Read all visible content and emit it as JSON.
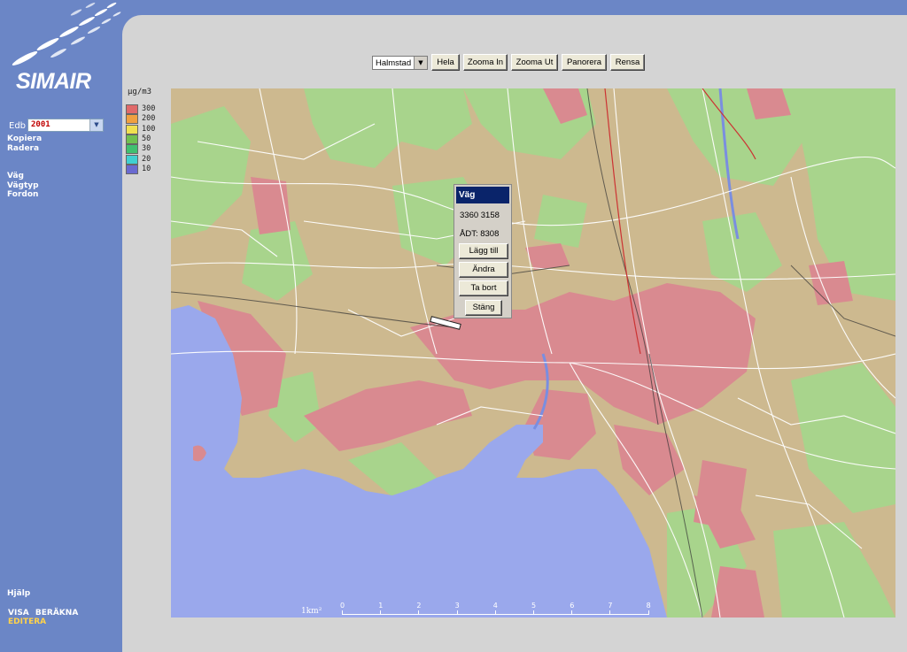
{
  "app": {
    "brand": "SIMAIR"
  },
  "sidebar": {
    "edb_label": "Edb",
    "edb_value": "2001",
    "links_top": [
      "Kopiera",
      "Radera"
    ],
    "links_edit": [
      "Väg",
      "Vägtyp",
      "Fordon"
    ],
    "help": "Hjälp",
    "nav": [
      {
        "label": "VISA",
        "color": "#ffffff"
      },
      {
        "label": "BERÄKNA",
        "color": "#ffffff"
      },
      {
        "label": "EDITERA",
        "color": "#ffd24a"
      }
    ]
  },
  "legend": {
    "unit": "µg/m3",
    "items": [
      {
        "label": "300",
        "color": "#e06a6a"
      },
      {
        "label": "200",
        "color": "#f0a040"
      },
      {
        "label": "100",
        "color": "#f0e050"
      },
      {
        "label": "50",
        "color": "#70c050"
      },
      {
        "label": "30",
        "color": "#40c070"
      },
      {
        "label": "20",
        "color": "#40d0d0"
      },
      {
        "label": "10",
        "color": "#6a6ad0"
      }
    ]
  },
  "toolbar": {
    "city_select": "Halmstad",
    "buttons": [
      "Hela",
      "Zooma In",
      "Zooma Ut",
      "Panorera",
      "Rensa"
    ]
  },
  "popup": {
    "title": "Väg",
    "coords": "3360 3158",
    "adt": "ÅDT: 8308",
    "buttons": [
      "Lägg till",
      "Ändra",
      "Ta bort",
      "Stäng"
    ]
  },
  "scale": {
    "label": "1km²",
    "ticks": [
      "0",
      "1",
      "2",
      "3",
      "4",
      "5",
      "6",
      "7",
      "8"
    ]
  },
  "colors": {
    "sidebar": "#6b86c6",
    "content_bg": "#d4d4d4",
    "map_land": "#cdb98f",
    "map_urban": "#d98a90",
    "map_forest": "#a8d48c",
    "map_water": "#9aa8ec"
  }
}
